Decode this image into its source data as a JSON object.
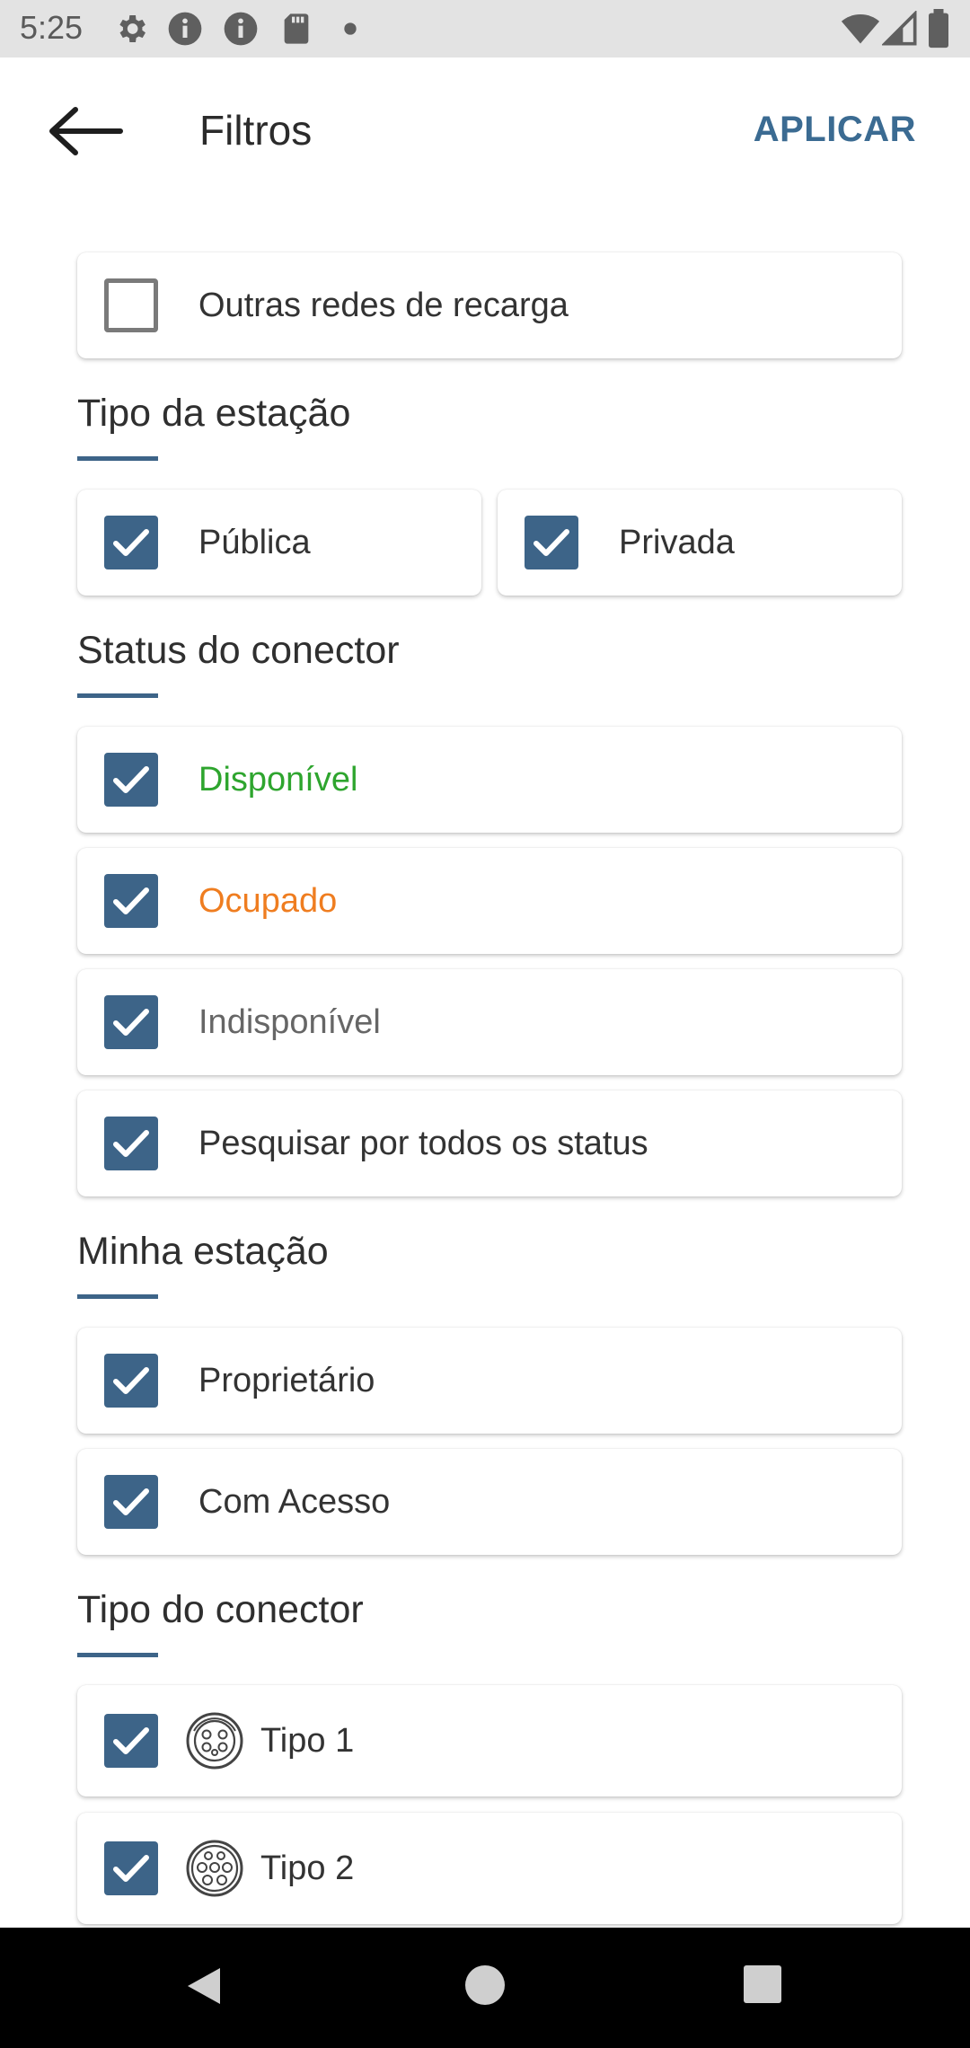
{
  "status_bar": {
    "time": "5:25",
    "left_icons": [
      "settings-gear-icon",
      "info-icon",
      "info-icon",
      "sd-card-icon",
      "dot-icon"
    ],
    "right_icons": [
      "wifi-icon",
      "signal-icon",
      "battery-icon"
    ]
  },
  "app_bar": {
    "back_icon": "arrow-left-icon",
    "title": "Filtros",
    "apply_label": "APLICAR"
  },
  "colors": {
    "accent": "#3d6488",
    "apply_text": "#3b6b92",
    "available": "#2ea52e",
    "occupied": "#ef7d20",
    "unavailable": "#666666"
  },
  "other_networks": {
    "label": "Outras redes de recarga",
    "checked": false
  },
  "station_type": {
    "heading": "Tipo da estação",
    "options": [
      {
        "label": "Pública",
        "checked": true
      },
      {
        "label": "Privada",
        "checked": true
      }
    ]
  },
  "connector_status": {
    "heading": "Status do conector",
    "options": [
      {
        "label": "Disponível",
        "checked": true
      },
      {
        "label": "Ocupado",
        "checked": true
      },
      {
        "label": "Indisponível",
        "checked": true
      },
      {
        "label": "Pesquisar por todos os status",
        "checked": true
      }
    ]
  },
  "my_station": {
    "heading": "Minha estação",
    "options": [
      {
        "label": "Proprietário",
        "checked": true
      },
      {
        "label": "Com Acesso",
        "checked": true
      }
    ]
  },
  "connector_type": {
    "heading": "Tipo do conector",
    "options": [
      {
        "label": "Tipo 1",
        "icon": "type1-connector-icon",
        "checked": true
      },
      {
        "label": "Tipo 2",
        "icon": "type2-connector-icon",
        "checked": true
      }
    ]
  },
  "nav_bar": {
    "icons": [
      "nav-back-icon",
      "nav-home-icon",
      "nav-recents-icon"
    ]
  }
}
